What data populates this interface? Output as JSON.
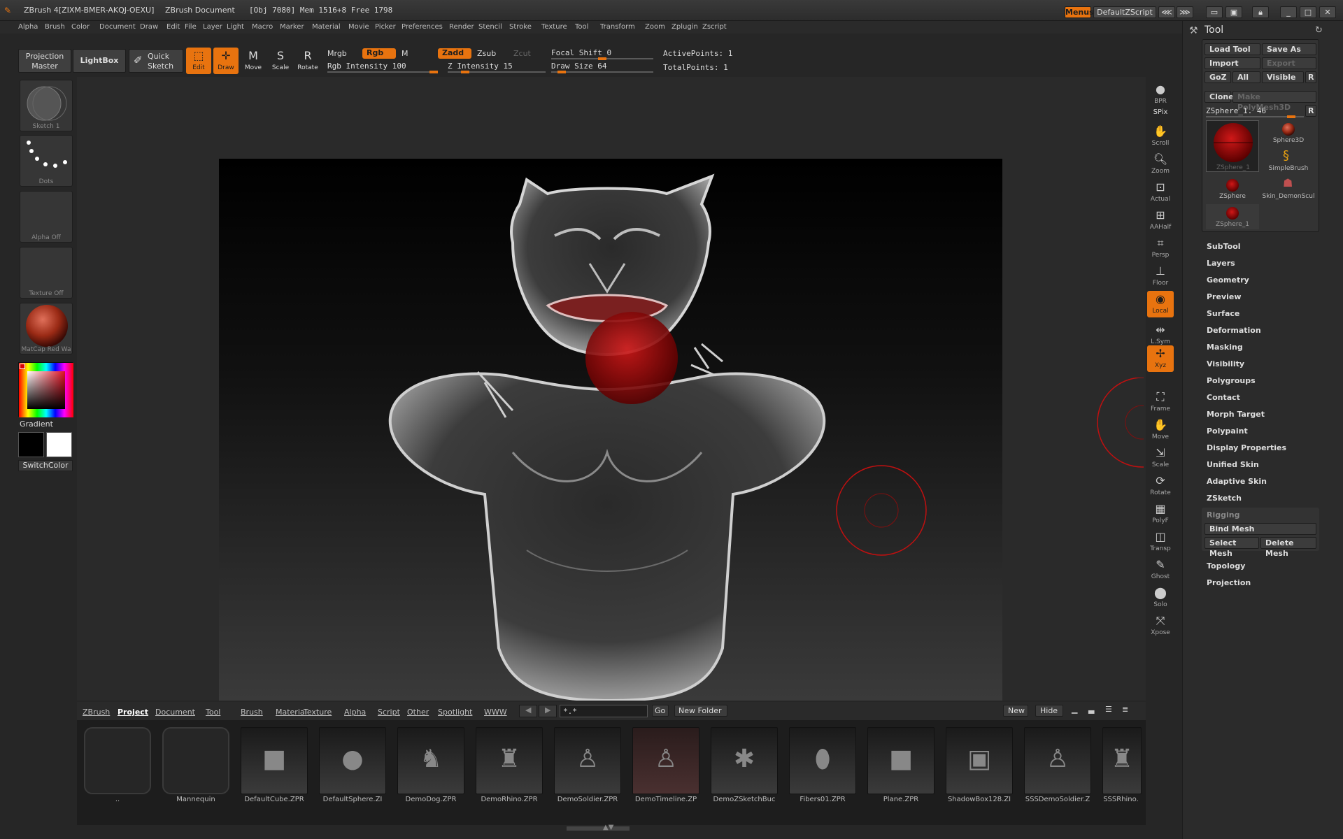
{
  "titlebar": {
    "app_title": "ZBrush 4[ZIXM-BMER-AKQJ-OEXU]",
    "document_title": "ZBrush Document",
    "stats": "[Obj 7080] Mem 1516+8 Free 1798",
    "menus_button": "Menus",
    "script_button": "DefaultZScript"
  },
  "menubar": {
    "items": [
      "Alpha",
      "Brush",
      "Color",
      "Document",
      "Draw",
      "Edit",
      "File",
      "Layer",
      "Light",
      "Macro",
      "Marker",
      "Material",
      "Movie",
      "Picker",
      "Preferences",
      "Render",
      "Stencil",
      "Stroke",
      "Texture",
      "Tool",
      "Transform",
      "Zoom",
      "Zplugin",
      "Zscript"
    ]
  },
  "shelf": {
    "projection_master": "Projection Master",
    "lightbox": "LightBox",
    "quick_sketch": "Quick Sketch",
    "tools": [
      {
        "label": "Edit",
        "active": true
      },
      {
        "label": "Draw",
        "active": true
      },
      {
        "label": "Move",
        "active": false
      },
      {
        "label": "Scale",
        "active": false
      },
      {
        "label": "Rotate",
        "active": false
      }
    ],
    "mrgb": "Mrgb",
    "rgb": "Rgb",
    "m": "M",
    "zadd": "Zadd",
    "zsub": "Zsub",
    "zcut": "Zcut",
    "rgb_intensity": "Rgb Intensity 100",
    "rgb_intensity_value": 100,
    "z_intensity": "Z Intensity 15",
    "z_intensity_value": 15,
    "focal_shift": "Focal Shift 0",
    "focal_shift_value": 0,
    "draw_size": "Draw Size 64",
    "draw_size_value": 64,
    "active_points": "ActivePoints: 1",
    "total_points": "TotalPoints: 1"
  },
  "lefttray": {
    "brush_label": "Sketch 1",
    "stroke_label": "Dots",
    "alpha_label": "Alpha Off",
    "texture_label": "Texture Off",
    "material_label": "MatCap Red Wa",
    "gradient_label": "Gradient",
    "switchcolor_label": "SwitchColor"
  },
  "rightshelf": {
    "items": [
      {
        "label": "BPR",
        "icon": "bpr-icon",
        "active": false
      },
      {
        "label": "SPix",
        "icon": "spix-icon",
        "active": false
      },
      {
        "label": "Scroll",
        "icon": "scroll-icon",
        "active": false
      },
      {
        "label": "Zoom",
        "icon": "zoom-icon",
        "active": false
      },
      {
        "label": "Actual",
        "icon": "actual-icon",
        "active": false
      },
      {
        "label": "AAHalf",
        "icon": "aahalf-icon",
        "active": false
      },
      {
        "label": "Persp",
        "icon": "persp-icon",
        "active": false
      },
      {
        "label": "Floor",
        "icon": "floor-icon",
        "active": false
      },
      {
        "label": "Local",
        "icon": "local-icon",
        "active": true
      },
      {
        "label": "L.Sym",
        "icon": "lsym-icon",
        "active": false
      },
      {
        "label": "Xyz",
        "icon": "xyz-icon",
        "active": true
      },
      {
        "label": "Frame",
        "icon": "frame-icon",
        "active": false
      },
      {
        "label": "Move",
        "icon": "move-icon",
        "active": false
      },
      {
        "label": "Scale",
        "icon": "scale-icon",
        "active": false
      },
      {
        "label": "Rotate",
        "icon": "rotate-icon",
        "active": false
      },
      {
        "label": "PolyF",
        "icon": "polyf-icon",
        "active": false
      },
      {
        "label": "Transp",
        "icon": "transp-icon",
        "active": false
      },
      {
        "label": "Ghost",
        "icon": "ghost-icon",
        "active": false
      },
      {
        "label": "Solo",
        "icon": "solo-icon",
        "active": false
      },
      {
        "label": "Xpose",
        "icon": "xpose-icon",
        "active": false
      }
    ]
  },
  "toolpal": {
    "title": "Tool",
    "load_tool": "Load Tool",
    "save_as": "Save As",
    "import": "Import",
    "export": "Export",
    "goz": "GoZ",
    "all": "All",
    "visible": "Visible",
    "r": "R",
    "clone": "Clone",
    "make_polymesh": "Make PolyMesh3D",
    "current_tool": "ZSphere_1. 46",
    "current_tool_value": 46,
    "tools": [
      "ZSphere_1",
      "Sphere3D",
      "SimpleBrush",
      "ZSphere",
      "Skin_DemonScul",
      "ZSphere_1"
    ],
    "sections": [
      "SubTool",
      "Layers",
      "Geometry",
      "Preview",
      "Surface",
      "Deformation",
      "Masking",
      "Visibility",
      "Polygroups",
      "Contact",
      "Morph Target",
      "Polypaint",
      "Display Properties",
      "Unified Skin",
      "Adaptive Skin",
      "ZSketch"
    ],
    "rigging": "Rigging",
    "bind_mesh": "Bind Mesh",
    "select_mesh": "Select Mesh",
    "delete_mesh": "Delete Mesh",
    "sections2": [
      "Topology",
      "Projection"
    ]
  },
  "lightbox": {
    "tabs": [
      "ZBrush",
      "Project",
      "Document",
      "Tool",
      "Brush",
      "Material",
      "Texture",
      "Alpha",
      "Script",
      "Other",
      "Spotlight",
      "WWW"
    ],
    "active_tab": "Project",
    "filter": "*.*",
    "go": "Go",
    "new_folder": "New Folder",
    "new": "New",
    "hide": "Hide",
    "items": [
      "..",
      "Mannequin",
      "DefaultCube.ZPR",
      "DefaultSphere.ZI",
      "DemoDog.ZPR",
      "DemoRhino.ZPR",
      "DemoSoldier.ZPR",
      "DemoTimeline.ZP",
      "DemoZSketchBuc",
      "Fibers01.ZPR",
      "Plane.ZPR",
      "ShadowBox128.ZI",
      "SSSDemoSoldier.Z",
      "SSSRhino."
    ]
  },
  "colors": {
    "accent": "#e8730f",
    "background": "#262626",
    "panel": "#2b2b2b",
    "red_brush": "#c41010"
  }
}
